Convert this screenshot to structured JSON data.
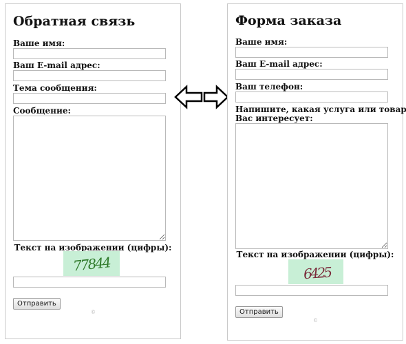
{
  "feedback_form": {
    "title": "Обратная связь",
    "fields": [
      {
        "label": "Ваше имя:",
        "value": ""
      },
      {
        "label": "Ваш E-mail адрес:",
        "value": ""
      },
      {
        "label": "Тема сообщения:",
        "value": ""
      }
    ],
    "message_label": "Сообщение:",
    "message_value": "",
    "captcha_label": "Текст на изображении (цифры):",
    "captcha_text": "77844",
    "captcha_value": "",
    "submit_label": "Отправить",
    "copyright": "©"
  },
  "order_form": {
    "title": "Форма заказа",
    "fields": [
      {
        "label": "Ваше имя:",
        "value": ""
      },
      {
        "label": "Ваш E-mail адрес:",
        "value": ""
      },
      {
        "label": "Ваш телефон:",
        "value": ""
      }
    ],
    "service_label_line1": "Напишите, какая услуга или товар",
    "service_label_line2": "Вас интересует:",
    "service_value": "",
    "captcha_label": "Текст на изображении (цифры):",
    "captcha_text": "6425",
    "captcha_value": "",
    "submit_label": "Отправить",
    "copyright": "©"
  },
  "icons": {
    "arrows": "double-arrow-left-right-icon"
  },
  "colors": {
    "captcha_bg": "#c8efd6",
    "captcha_text_left": "#2f7a2a",
    "captcha_text_right": "#7a2a3a",
    "panel_border": "#c9c9c9"
  }
}
